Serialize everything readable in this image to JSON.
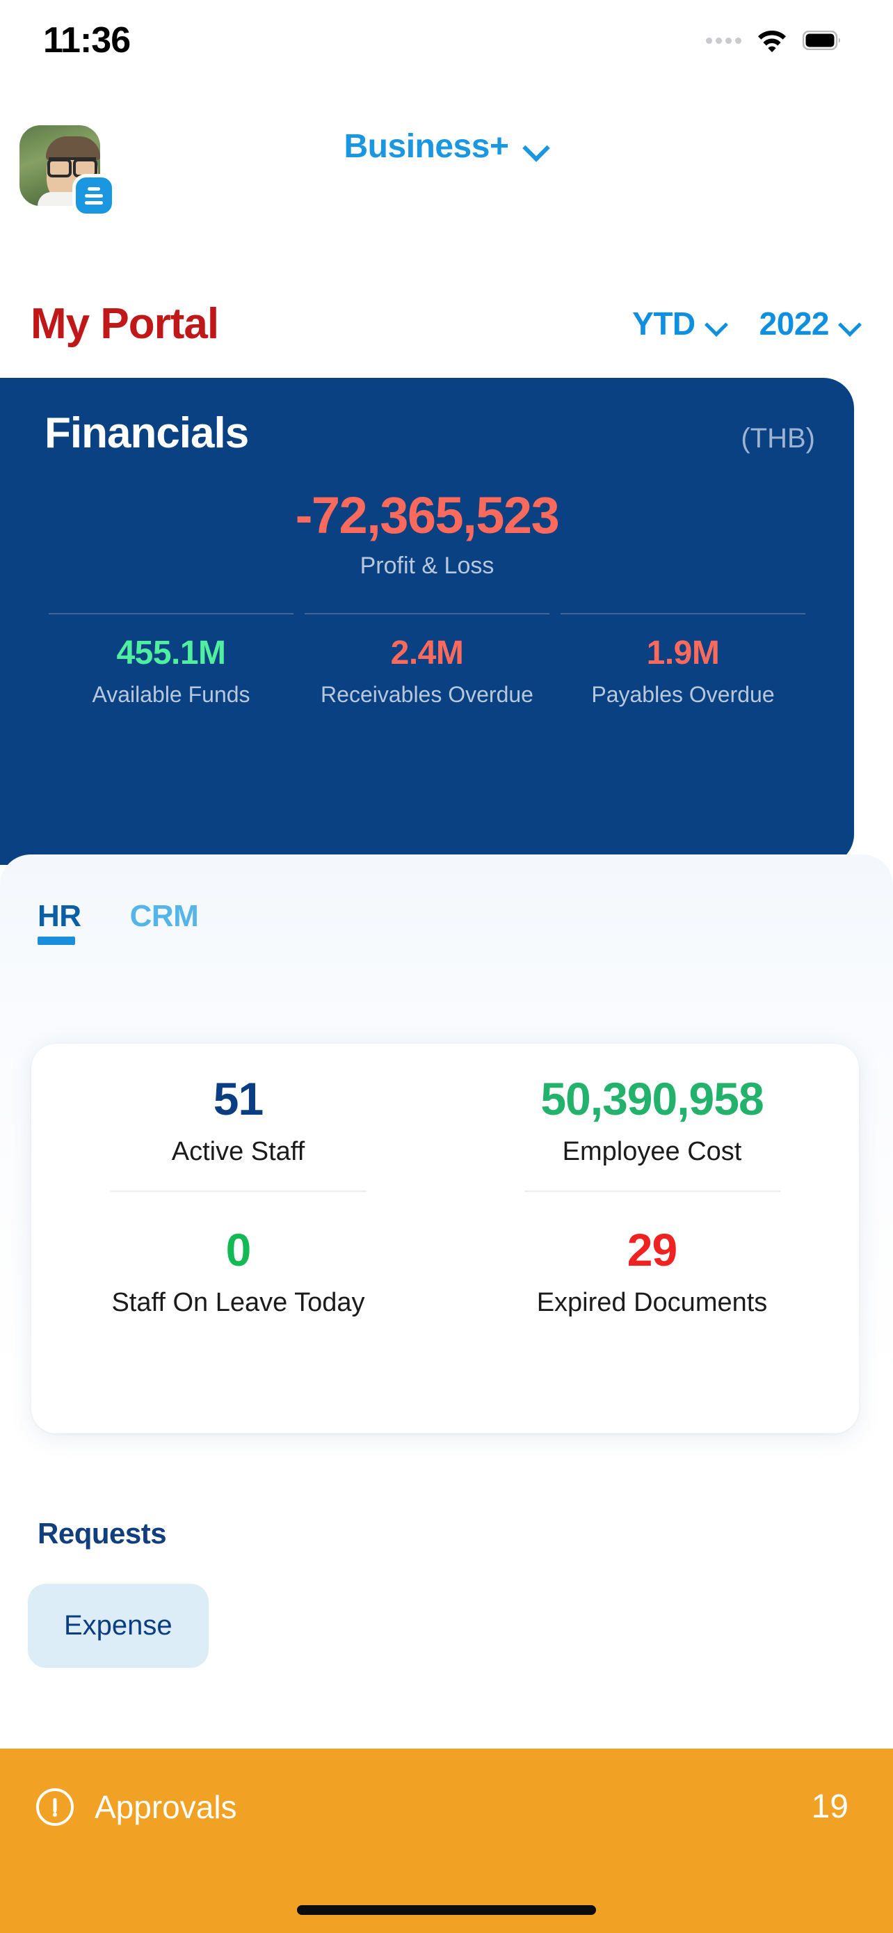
{
  "status_bar": {
    "time": "11:36",
    "cellular_icon": "cellular-signal-icon",
    "wifi_icon": "wifi-icon",
    "battery_icon": "battery-icon"
  },
  "top_nav": {
    "avatar_name": "user-avatar",
    "avatar_badge_icon": "menu-badge-icon",
    "workspace_label": "Business+",
    "workspace_chevron_icon": "chevron-down-icon"
  },
  "header": {
    "page_title": "My Portal",
    "filters": [
      {
        "label": "YTD",
        "icon": "chevron-down-icon"
      },
      {
        "label": "2022",
        "icon": "chevron-down-icon"
      }
    ]
  },
  "financials": {
    "title": "Financials",
    "currency": "(THB)",
    "hero": {
      "value": "-72,365,523",
      "label": "Profit & Loss",
      "color": "#FC6A5D"
    },
    "metrics": [
      {
        "value": "455.1M",
        "label": "Available Funds",
        "tone": "pos",
        "color": "#50EFA0"
      },
      {
        "value": "2.4M",
        "label": "Receivables Overdue",
        "tone": "neg",
        "color": "#FC6A5D"
      },
      {
        "value": "1.9M",
        "label": "Payables Overdue",
        "tone": "neg",
        "color": "#FC6A5D"
      }
    ],
    "card_color": "#0A4182"
  },
  "panel": {
    "tabs": [
      {
        "label": "HR",
        "active": true,
        "color": "#0B5FA5"
      },
      {
        "label": "CRM",
        "active": false,
        "color": "#53B5EA"
      }
    ],
    "hr_stats": [
      {
        "value": "51",
        "label": "Active Staff",
        "color": "#0B3D82"
      },
      {
        "value": "50,390,958",
        "label": "Employee Cost",
        "color": "#23B26B"
      },
      {
        "value": "0",
        "label": "Staff On Leave Today",
        "color": "#12B954"
      },
      {
        "value": "29",
        "label": "Expired Documents",
        "color": "#F02121"
      }
    ]
  },
  "requests": {
    "title": "Requests",
    "chips": [
      {
        "label": "Expense"
      }
    ]
  },
  "approvals": {
    "icon": "alert-circle-icon",
    "label": "Approvals",
    "count": "19",
    "bar_color": "#F1A224"
  }
}
